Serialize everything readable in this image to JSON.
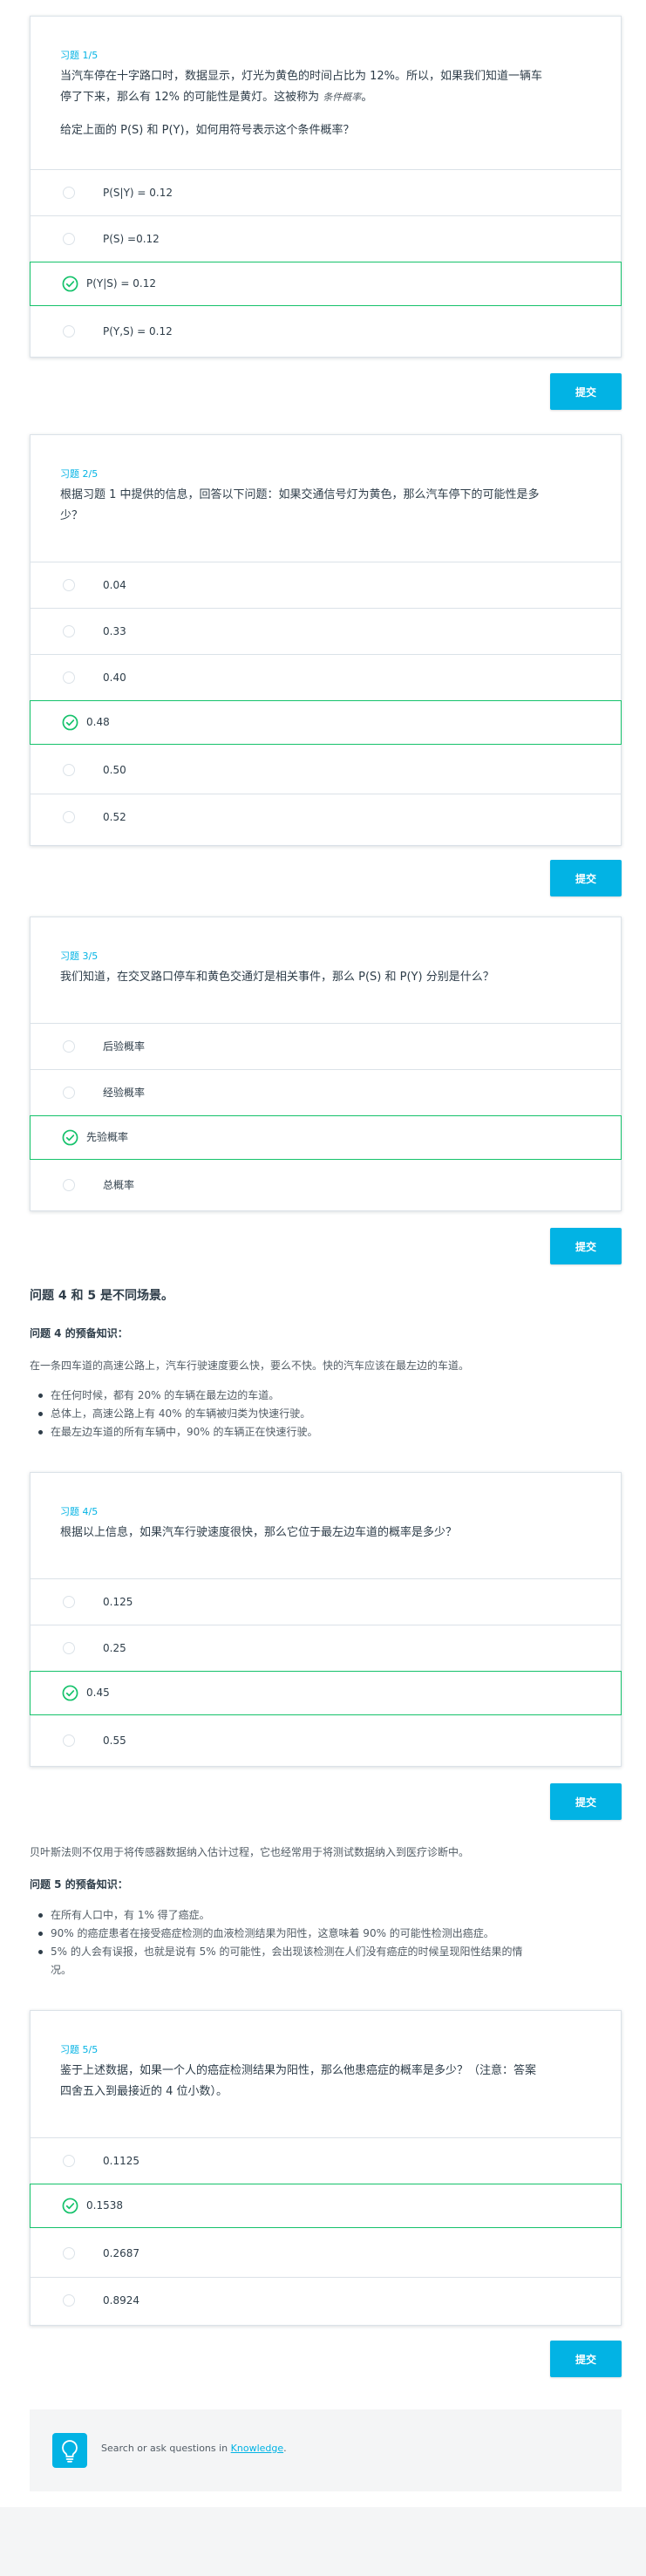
{
  "quizzes": [
    {
      "number": "习题 1/5",
      "question_line1": "当汽车停在十字路口时，数据显示，灯光为黄色的时间占比为 12%。所以，如果我们知道一辆车",
      "question_line2": "停了下来，那么有 12% 的可能性是黄灯。这被称为",
      "question_em": "条件概率",
      "question_end": "。",
      "question_2": "给定上面的 P(S) 和 P(Y)，如何用符号表示这个条件概率？",
      "options": [
        "P(S|Y) = 0.12",
        "P(S) =0.12",
        "P(Y|S) = 0.12",
        "P(Y,S) = 0.12"
      ],
      "selected_index": 2,
      "submit_label": "提交"
    },
    {
      "number": "习题 2/5",
      "question_line1": "根据习题 1 中提供的信息，回答以下问题：如果交通信号灯为黄色，那么汽车停下的可能性是多",
      "question_line2": "少？",
      "options": [
        "0.04",
        "0.33",
        "0.40",
        "0.48",
        "0.50",
        "0.52"
      ],
      "selected_index": 3,
      "submit_label": "提交"
    },
    {
      "number": "习题 3/5",
      "question_line1": "我们知道，在交叉路口停车和黄色交通灯是相关事件，那么 P(S) 和 P(Y) 分别是什么？",
      "options": [
        "后验概率",
        "经验概率",
        "先验概率",
        "总概率"
      ],
      "selected_index": 2,
      "submit_label": "提交"
    },
    {
      "number": "习题 4/5",
      "question_line1": "根据以上信息，如果汽车行驶速度很快，那么它位于最左边车道的概率是多少？",
      "options": [
        "0.125",
        "0.25",
        "0.45",
        "0.55"
      ],
      "selected_index": 2,
      "submit_label": "提交"
    },
    {
      "number": "习题 5/5",
      "question_line1": "鉴于上述数据，如果一个人的癌症检测结果为阳性，那么他患癌症的概率是多少？（注意：答案",
      "question_line2": "四舍五入到最接近的 4 位小数）。",
      "options": [
        "0.1125",
        "0.1538",
        "0.2687",
        "0.8924"
      ],
      "selected_index": 1,
      "submit_label": "提交"
    }
  ],
  "scenario": {
    "heading": "问题 4 和 5 是不同场景。",
    "q4_prior_heading": "问题 4 的预备知识：",
    "q4_intro": "在一条四车道的高速公路上，汽车行驶速度要么快，要么不快。快的汽车应该在最左边的车道。",
    "q4_bullets": [
      "在任何时候，都有 20% 的车辆在最左边的车道。",
      "总体上，高速公路上有 40% 的车辆被归类为快速行驶。",
      "在最左边车道的所有车辆中，90% 的车辆正在快速行驶。"
    ],
    "bayes_note": "贝叶斯法则不仅用于将传感器数据纳入估计过程，它也经常用于将测试数据纳入到医疗诊断中。",
    "q5_prior_heading": "问题 5 的预备知识：",
    "q5_bullets": [
      "在所有人口中，有 1% 得了癌症。",
      "90% 的癌症患者在接受癌症检测的血液检测结果为阳性，这意味着 90% 的可能性检测出癌症。",
      "5% 的人会有误报，也就是说有 5% 的可能性，会出现该检测在人们没有癌症的时候呈现阳性结果的情",
      "况。"
    ]
  },
  "knowledge": {
    "prefix": "Search or ask questions in ",
    "link": "Knowledge",
    "suffix": ".",
    "icon": "lightbulb-icon"
  },
  "colors": {
    "accent": "#02b3e4",
    "selected": "#15c26b",
    "text": "#2e3d49"
  }
}
